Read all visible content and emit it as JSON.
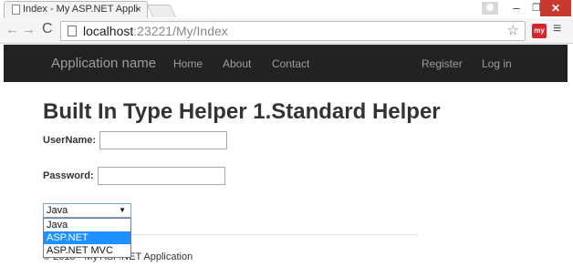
{
  "browser": {
    "tab_title": "Index - My ASP.NET Appli",
    "tab_close": "×",
    "window_minimize": "–",
    "window_maximize": "❐",
    "window_close": "✕",
    "url_host": "localhost",
    "url_port_path": ":23221/My/Index",
    "extension_label": "my"
  },
  "navbar": {
    "brand": "Application name",
    "links": [
      "Home",
      "About",
      "Contact"
    ],
    "right_links": [
      "Register",
      "Log in"
    ]
  },
  "page": {
    "title": "Built In Type Helper 1.Standard Helper",
    "username_label": "UserName:",
    "username_value": "",
    "password_label": "Password:",
    "password_value": "",
    "select": {
      "selected": "Java",
      "options": [
        {
          "label": "Java",
          "highlighted": false
        },
        {
          "label": "ASP.NET",
          "highlighted": true
        },
        {
          "label": "ASP.NET MVC",
          "highlighted": false
        }
      ]
    },
    "footer": "© 2015 - My ASP.NET Application"
  },
  "colors": {
    "navbar_bg": "#222222",
    "nav_text": "#9d9d9d",
    "option_highlight": "#1e90ff",
    "window_close_bg": "#c7392c"
  },
  "icons": [
    "page-icon",
    "back-arrow-icon",
    "forward-arrow-icon",
    "reload-icon",
    "star-icon",
    "menu-icon",
    "profile-icon"
  ]
}
